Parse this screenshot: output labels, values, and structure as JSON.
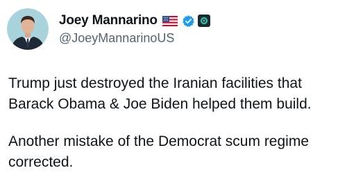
{
  "author": {
    "display_name": "Joey Mannarino",
    "handle": "@JoeyMannarinoUS",
    "flag_icon": "us-flag-icon",
    "verified_icon": "verified-badge-icon",
    "affiliation_icon": "affiliate-badge-icon"
  },
  "tweet": {
    "paragraph_1_line_1": "Trump just destroyed the Iranian facilities that",
    "paragraph_1_line_2": "Barack Obama & Joe Biden helped them build.",
    "paragraph_2_line_1": "Another mistake of the Democrat scum regime",
    "paragraph_2_line_2": "corrected."
  },
  "colors": {
    "text": "#0f1419",
    "secondary_text": "#536471",
    "verified_blue": "#1d9bf0",
    "background": "#ffffff"
  }
}
